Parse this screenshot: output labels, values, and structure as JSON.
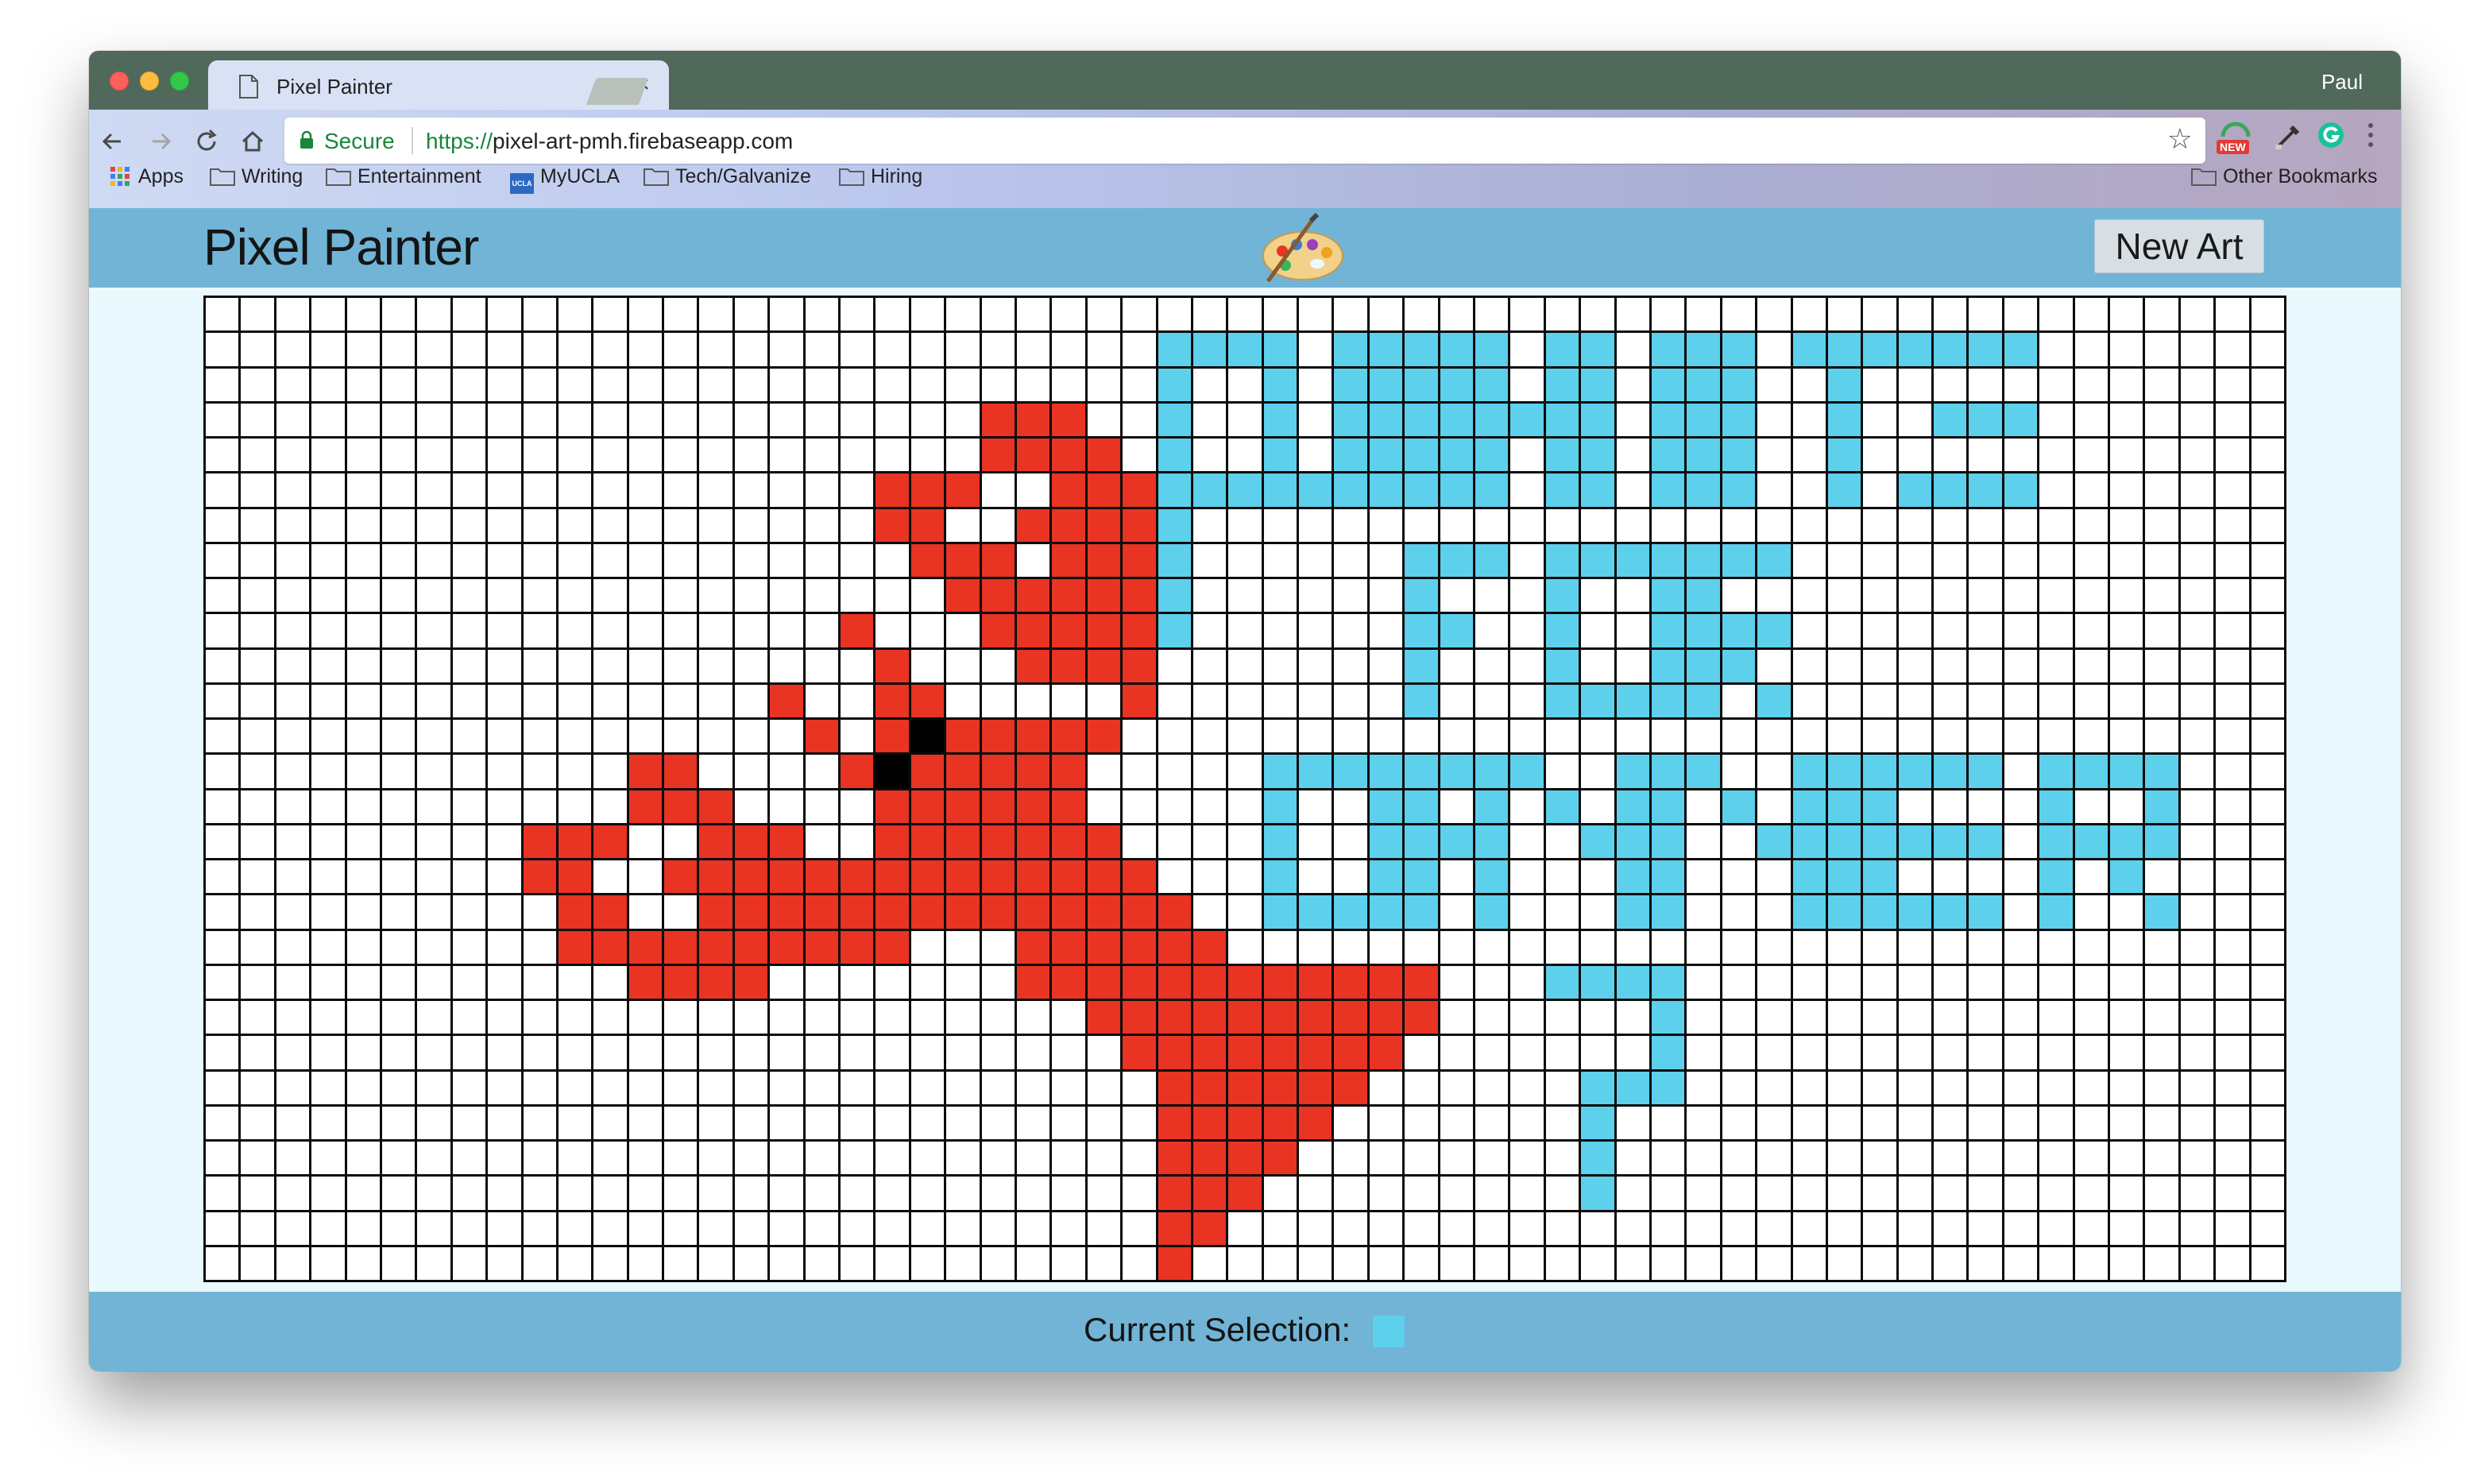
{
  "browser": {
    "tab_title": "Pixel Painter",
    "tab_close": "×",
    "profile_name": "Paul",
    "secure_label": "Secure",
    "url_scheme": "https://",
    "url_host": "pixel-art-pmh.firebaseapp.com",
    "extension_badge": "NEW",
    "bookmarks": [
      "Apps",
      "Writing",
      "Entertainment",
      "MyUCLA",
      "Tech/Galvanize",
      "Hiring"
    ],
    "other_bookmarks": "Other Bookmarks",
    "ucla_badge": "UCLA"
  },
  "app": {
    "title": "Pixel Painter",
    "new_art_label": "New Art",
    "footer_label": "Current Selection:",
    "current_color": "#5dd0ec"
  },
  "colors": {
    "white": "#ffffff",
    "red": "#e93323",
    "black": "#000000",
    "blue": "#5dd0ec"
  },
  "grid": {
    "cols": 59,
    "legend": {
      ".": "white",
      "R": "red",
      "K": "black",
      "B": "blue"
    },
    "rows": [
      "...........................................................",
      "...........................................................",
      "...........................................................",
      "...........................................................",
      "...........................................................",
      "...........................................................",
      "...........................................................",
      "...........................................................",
      "...........................................................",
      "...........................................................",
      "...........................................................",
      "...........................................................",
      "...........................................................",
      "...........................................................",
      "...........................................................",
      "...........................................................",
      "...........................................................",
      "...........................................................",
      "...........................................................",
      "...........................................................",
      "...........................................................",
      "...........................................................",
      "...........................................................",
      "...........................................................",
      "...........................................................",
      "...........................................................",
      "...........................................................",
      "..........................................................."
    ],
    "red_runs": [
      [
        3,
        22,
        24
      ],
      [
        4,
        22,
        25
      ],
      [
        5,
        19,
        21
      ],
      [
        5,
        24,
        26
      ],
      [
        6,
        19,
        20
      ],
      [
        6,
        23,
        26
      ],
      [
        7,
        20,
        22
      ],
      [
        7,
        24,
        26
      ],
      [
        8,
        21,
        26
      ],
      [
        9,
        18,
        18
      ],
      [
        9,
        22,
        26
      ],
      [
        10,
        19,
        19
      ],
      [
        10,
        23,
        26
      ],
      [
        11,
        16,
        16
      ],
      [
        11,
        19,
        19
      ],
      [
        11,
        20,
        20
      ],
      [
        11,
        26,
        26
      ],
      [
        12,
        17,
        17
      ],
      [
        12,
        19,
        19
      ],
      [
        12,
        21,
        25
      ],
      [
        13,
        12,
        13
      ],
      [
        13,
        18,
        18
      ],
      [
        13,
        20,
        24
      ],
      [
        14,
        12,
        14
      ],
      [
        14,
        19,
        24
      ],
      [
        15,
        9,
        11
      ],
      [
        15,
        14,
        16
      ],
      [
        15,
        19,
        25
      ],
      [
        16,
        9,
        10
      ],
      [
        16,
        13,
        26
      ],
      [
        17,
        10,
        11
      ],
      [
        17,
        14,
        27
      ],
      [
        18,
        10,
        19
      ],
      [
        18,
        23,
        28
      ],
      [
        19,
        12,
        15
      ],
      [
        19,
        23,
        34
      ],
      [
        20,
        25,
        34
      ],
      [
        21,
        26,
        33
      ],
      [
        22,
        27,
        32
      ],
      [
        23,
        27,
        31
      ],
      [
        24,
        27,
        30
      ],
      [
        25,
        27,
        29
      ],
      [
        26,
        27,
        28
      ],
      [
        27,
        27,
        27
      ]
    ],
    "black_cells": [
      [
        12,
        20
      ],
      [
        13,
        19
      ]
    ],
    "blue_rects": [
      [
        1,
        27,
        1,
        4
      ],
      [
        2,
        27,
        4,
        1
      ],
      [
        5,
        27,
        5,
        1
      ],
      [
        1,
        30,
        4,
        1
      ],
      [
        1,
        32,
        5,
        1
      ],
      [
        1,
        33,
        5,
        1
      ],
      [
        5,
        28,
        1,
        5
      ],
      [
        1,
        34,
        5,
        1
      ],
      [
        1,
        35,
        5,
        1
      ],
      [
        1,
        36,
        5,
        1
      ],
      [
        3,
        37,
        1,
        1
      ],
      [
        1,
        38,
        5,
        1
      ],
      [
        1,
        39,
        5,
        1
      ],
      [
        1,
        41,
        5,
        3
      ],
      [
        2,
        42,
        1,
        1
      ],
      [
        3,
        42,
        1,
        1
      ],
      [
        1,
        45,
        1,
        3
      ],
      [
        2,
        46,
        4,
        1
      ],
      [
        1,
        47,
        1,
        1
      ],
      [
        1,
        48,
        1,
        1
      ],
      [
        1,
        49,
        1,
        3
      ],
      [
        3,
        49,
        1,
        3
      ],
      [
        5,
        49,
        1,
        3
      ],
      [
        1,
        50,
        1,
        1
      ],
      [
        5,
        48,
        1,
        1
      ],
      [
        7,
        34,
        5,
        1
      ],
      [
        7,
        35,
        1,
        2
      ],
      [
        9,
        35,
        1,
        1
      ],
      [
        7,
        38,
        5,
        1
      ],
      [
        7,
        39,
        1,
        2
      ],
      [
        11,
        39,
        1,
        2
      ],
      [
        7,
        41,
        5,
        1
      ],
      [
        7,
        42,
        5,
        1
      ],
      [
        7,
        43,
        1,
        2
      ],
      [
        9,
        43,
        1,
        2
      ],
      [
        10,
        43,
        1,
        1
      ],
      [
        11,
        44,
        1,
        1
      ],
      [
        13,
        30,
        5,
        1
      ],
      [
        13,
        31,
        1,
        2
      ],
      [
        17,
        31,
        1,
        2
      ],
      [
        13,
        33,
        5,
        1
      ],
      [
        13,
        34,
        5,
        1
      ],
      [
        13,
        35,
        1,
        1
      ],
      [
        15,
        35,
        1,
        1
      ],
      [
        13,
        36,
        5,
        1
      ],
      [
        13,
        37,
        1,
        1
      ],
      [
        14,
        38,
        1,
        1
      ],
      [
        15,
        39,
        1,
        1
      ],
      [
        16,
        40,
        1,
        1
      ],
      [
        13,
        40,
        5,
        1
      ],
      [
        13,
        41,
        5,
        1
      ],
      [
        13,
        42,
        1,
        1
      ],
      [
        14,
        43,
        1,
        1
      ],
      [
        15,
        44,
        1,
        1
      ],
      [
        13,
        45,
        5,
        1
      ],
      [
        13,
        46,
        5,
        1
      ],
      [
        13,
        47,
        5,
        1
      ],
      [
        13,
        48,
        1,
        3
      ],
      [
        15,
        48,
        1,
        3
      ],
      [
        17,
        48,
        1,
        3
      ],
      [
        13,
        49,
        1,
        1
      ],
      [
        13,
        50,
        1,
        1
      ],
      [
        13,
        52,
        5,
        1
      ],
      [
        13,
        53,
        1,
        3
      ],
      [
        15,
        53,
        1,
        3
      ],
      [
        13,
        55,
        3,
        1
      ],
      [
        16,
        54,
        1,
        1
      ],
      [
        17,
        55,
        1,
        1
      ],
      [
        19,
        38,
        1,
        4
      ],
      [
        20,
        41,
        1,
        1
      ],
      [
        21,
        41,
        1,
        1
      ],
      [
        22,
        39,
        1,
        3
      ],
      [
        23,
        39,
        1,
        1
      ],
      [
        24,
        39,
        1,
        1
      ],
      [
        25,
        39,
        1,
        1
      ]
    ]
  }
}
